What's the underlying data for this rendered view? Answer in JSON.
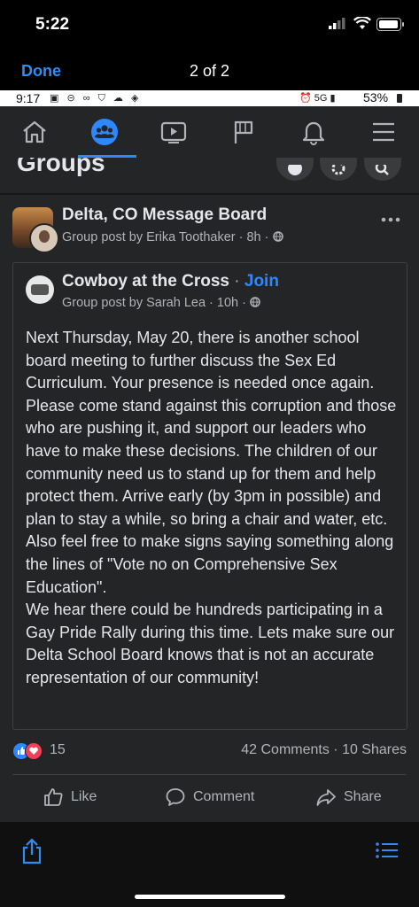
{
  "ios_status": {
    "time": "5:22"
  },
  "viewer": {
    "done_label": "Done",
    "page_counter": "2 of 2"
  },
  "android_status": {
    "time": "9:17",
    "left_icons": "▣ ⊝ ∞ ⛉ ☁ ◈",
    "right_icons": "⏰ 5G ▮",
    "battery": "53%"
  },
  "fb_nav": {
    "items": [
      "home-icon",
      "groups-icon",
      "watch-icon",
      "pages-flag-icon",
      "notifications-bell-icon",
      "menu-icon"
    ],
    "active": "groups-icon",
    "accent": "#2d88ff"
  },
  "groups_header": {
    "title": "Groups"
  },
  "post": {
    "group_name": "Delta, CO Message Board",
    "meta": "Group post by Erika Toothaker · 8h · ",
    "shared": {
      "group_name": "Cowboy at the Cross",
      "separator": " · ",
      "join_label": "Join",
      "meta": "Group post by Sarah Lea · 10h · ",
      "text": "Next Thursday, May 20, there is another school board meeting to further discuss the Sex Ed Curriculum. Your presence is needed once again. Please come stand against this corruption and those who are pushing it, and support our leaders who have to make these decisions. The children of our community need us to stand up for them and help protect them. Arrive early (by 3pm in possible) and plan to stay a while, so bring a chair and water, etc. Also feel free to make signs saying something along the lines of \"Vote no on Comprehensive Sex Education\".\nWe hear there could be hundreds participating in a Gay Pride Rally during this time. Lets make sure our Delta School Board knows that is not an accurate representation of our community!"
    },
    "reaction_count": "15",
    "comments": "42 Comments",
    "dot": " · ",
    "shares": "10 Shares",
    "actions": {
      "like": "Like",
      "comment": "Comment",
      "share": "Share"
    }
  },
  "bottom_bar": {
    "share_icon": "share-icon",
    "list_icon": "list-icon",
    "accent": "#2f8cf0"
  }
}
